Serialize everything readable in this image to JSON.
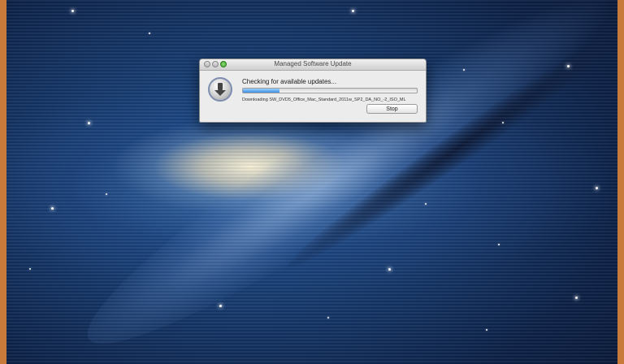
{
  "window": {
    "title": "Managed Software Update",
    "status_text": "Checking for available updates...",
    "detail_text": "Downloading SW_DVD5_Office_Mac_Standard_2011w_SP2_DA_NO_-2_ISO_ML",
    "progress": 0.21,
    "stop_label": "Stop",
    "icon": "software-update-icon"
  },
  "colors": {
    "progress_fill": "#3f8ee0",
    "screen_bezel": "#c77a3a"
  }
}
